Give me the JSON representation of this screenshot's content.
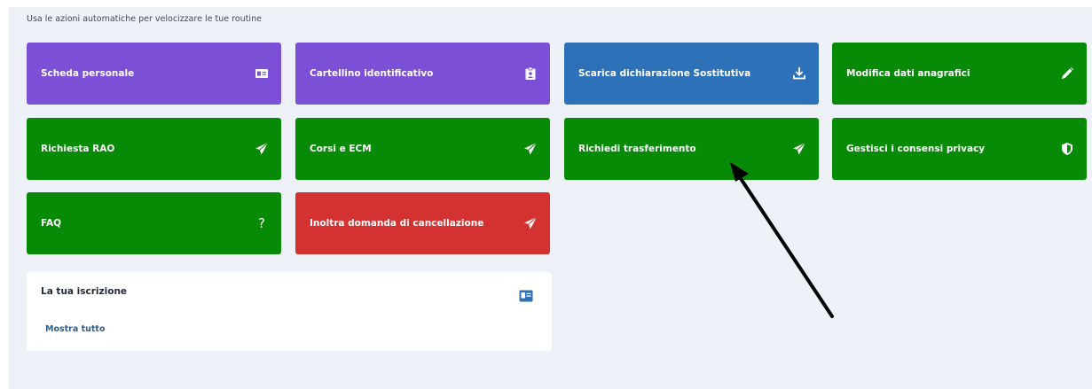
{
  "subtitle": "Usa le azioni automatiche per velocizzare le tue routine",
  "colors": {
    "purple": "#7b4fd6",
    "blue": "#2d72b8",
    "green": "#078b07",
    "red": "#d43131",
    "panel": "#eef1f7"
  },
  "tiles": [
    {
      "label": "Scheda personale",
      "icon": "id-card-icon",
      "color": "purple"
    },
    {
      "label": "Cartellino identificativo",
      "icon": "id-badge-icon",
      "color": "purple"
    },
    {
      "label": "Scarica dichiarazione Sostitutiva",
      "icon": "download-icon",
      "color": "blue"
    },
    {
      "label": "Modifica dati anagrafici",
      "icon": "pencil-icon",
      "color": "green"
    },
    {
      "label": "Richiesta RAO",
      "icon": "paper-plane-icon",
      "color": "green"
    },
    {
      "label": "Corsi e ECM",
      "icon": "paper-plane-icon",
      "color": "green"
    },
    {
      "label": "Richiedi trasferimento",
      "icon": "paper-plane-icon",
      "color": "green"
    },
    {
      "label": "Gestisci i consensi privacy",
      "icon": "shield-icon",
      "color": "green"
    },
    {
      "label": "FAQ",
      "icon": "question-icon",
      "icon_text": "?",
      "color": "green"
    },
    {
      "label": "Inoltra domanda di cancellazione",
      "icon": "paper-plane-icon",
      "color": "red"
    }
  ],
  "card": {
    "title": "La tua iscrizione",
    "icon": "id-card-icon",
    "link": "Mostra tutto"
  }
}
